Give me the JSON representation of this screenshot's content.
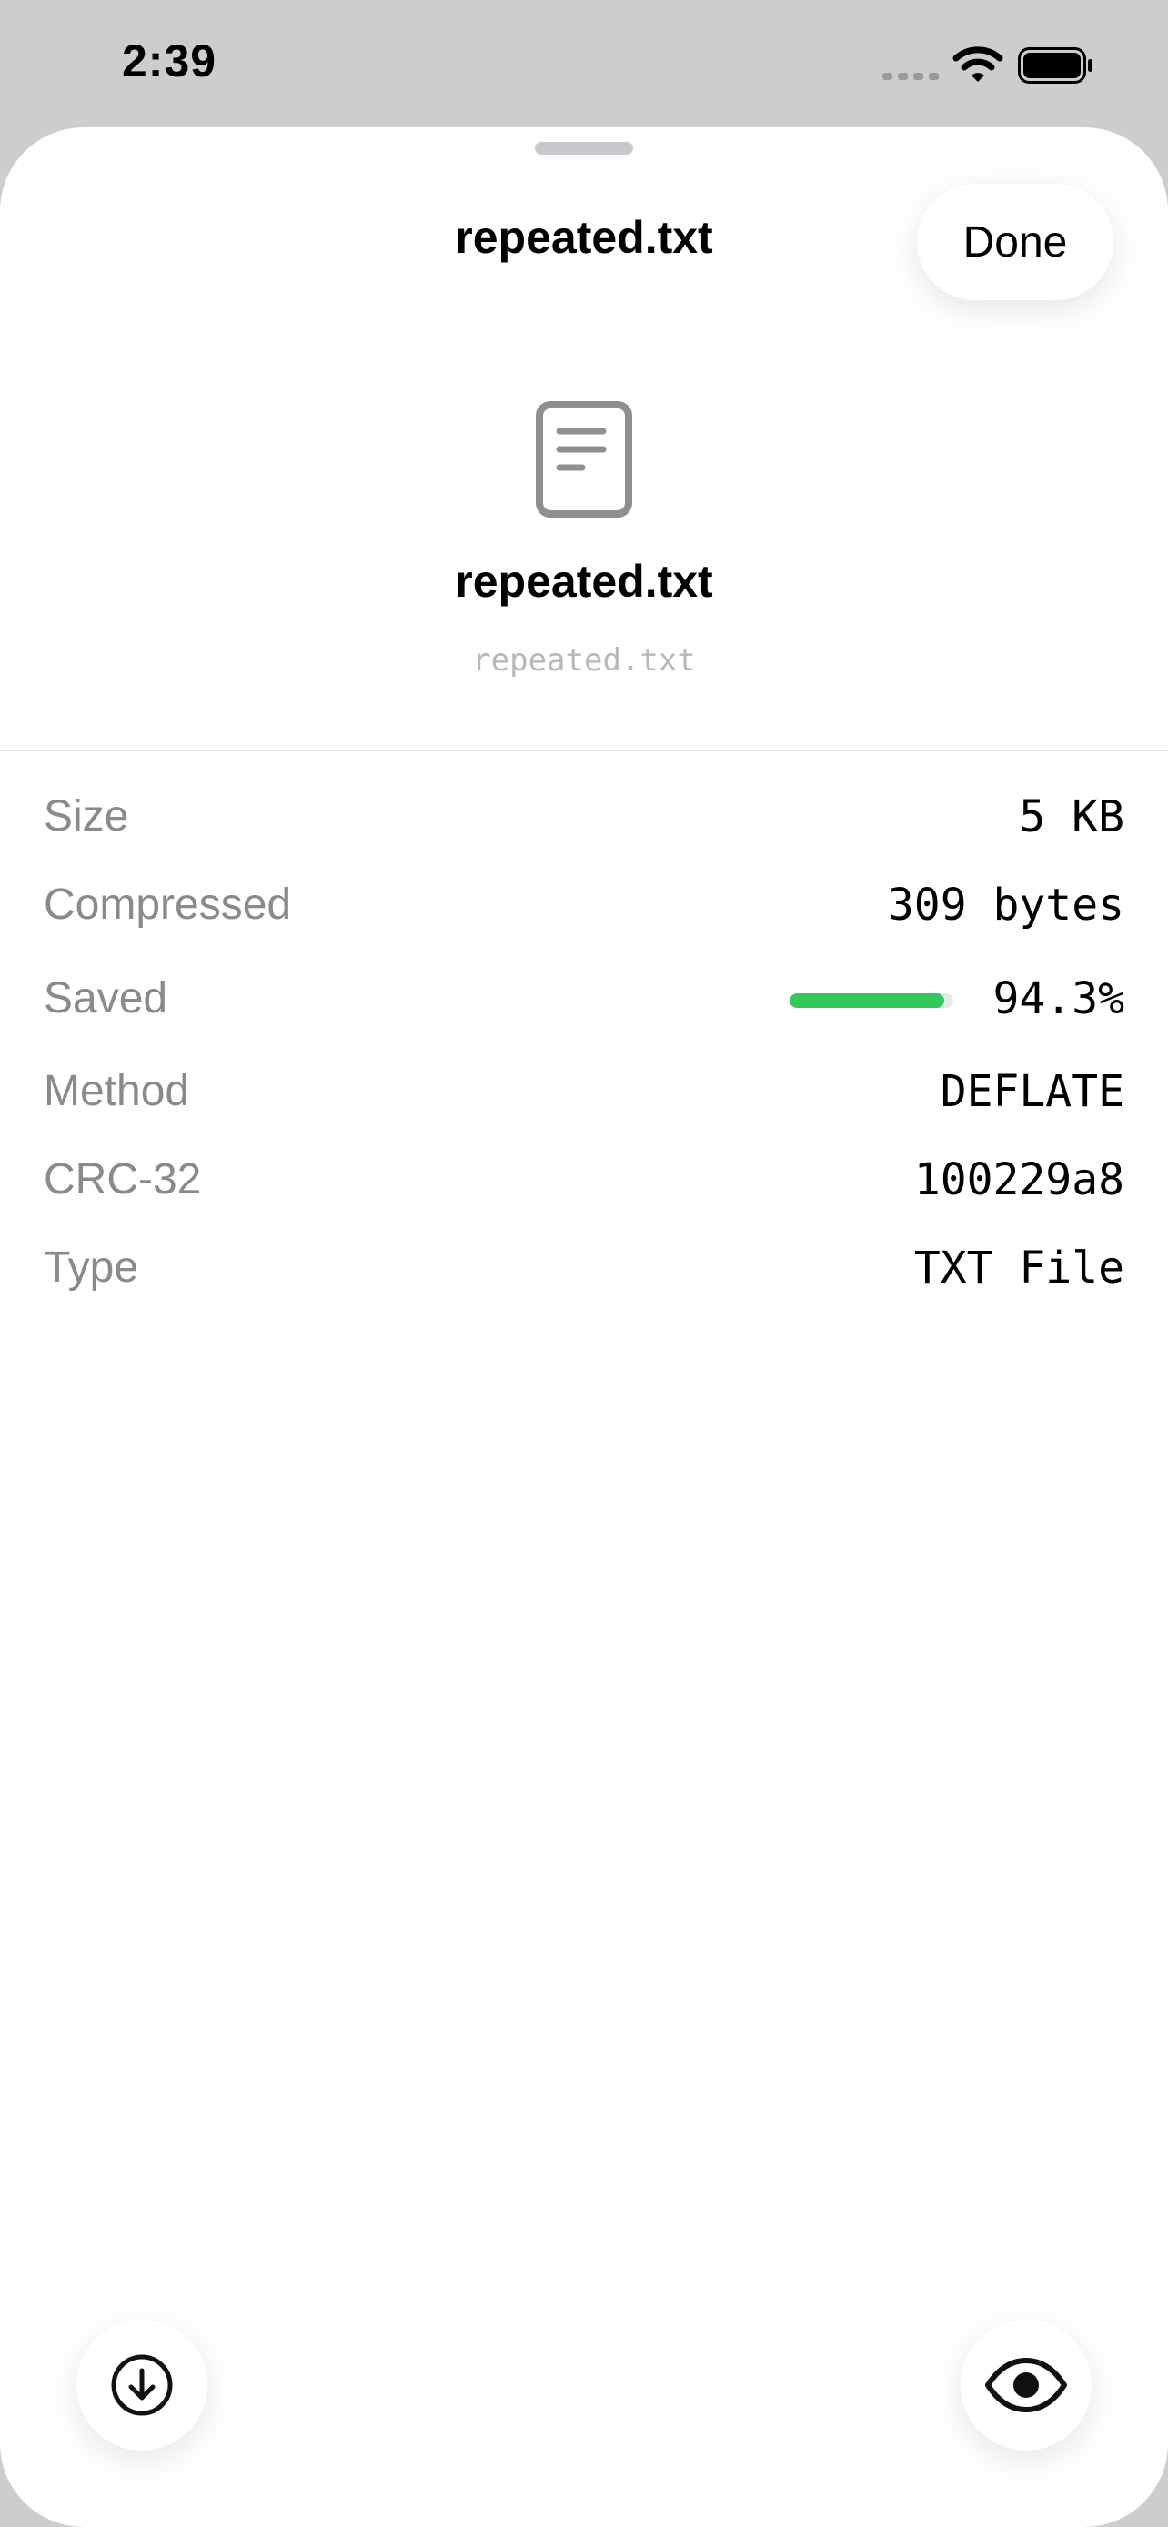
{
  "status_bar": {
    "time": "2:39",
    "icons": [
      "cellular-signal-icon",
      "wifi-icon",
      "battery-icon"
    ]
  },
  "sheet": {
    "title": "repeated.txt",
    "done_label": "Done"
  },
  "file": {
    "icon": "document-icon",
    "name": "repeated.txt",
    "path": "repeated.txt"
  },
  "info": {
    "size": {
      "label": "Size",
      "value": "5 KB"
    },
    "compressed": {
      "label": "Compressed",
      "value": "309 bytes"
    },
    "saved": {
      "label": "Saved",
      "value": "94.3%",
      "fraction": 0.943
    },
    "method": {
      "label": "Method",
      "value": "DEFLATE"
    },
    "crc": {
      "label": "CRC-32",
      "value": "100229a8"
    },
    "type": {
      "label": "Type",
      "value": "TXT File"
    }
  },
  "actions": {
    "download_icon": "download-icon",
    "preview_icon": "eye-icon"
  },
  "colors": {
    "saved_bar": "#34c759",
    "secondary_text": "#8a8a8e"
  }
}
